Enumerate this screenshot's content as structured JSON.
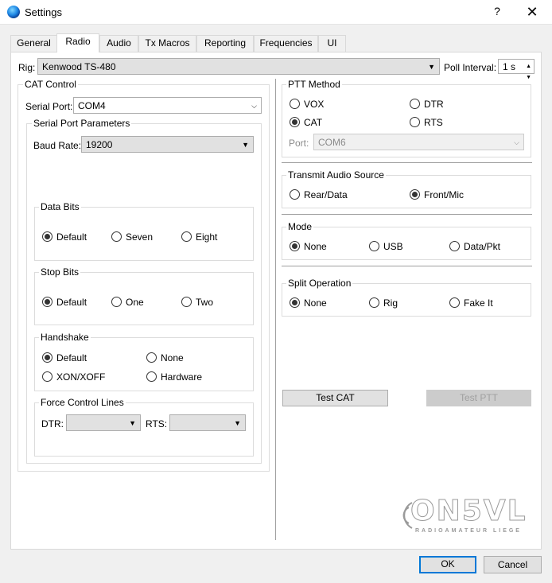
{
  "window": {
    "title": "Settings",
    "help_glyph": "?",
    "close_glyph": "✕"
  },
  "tabs": [
    {
      "label": "General"
    },
    {
      "label": "Radio",
      "active": true
    },
    {
      "label": "Audio"
    },
    {
      "label": "Tx Macros"
    },
    {
      "label": "Reporting"
    },
    {
      "label": "Frequencies"
    },
    {
      "label": "UI"
    }
  ],
  "rig": {
    "label": "Rig:",
    "value": "Kenwood TS-480",
    "poll_label": "Poll Interval:",
    "poll_value": "1 s"
  },
  "cat": {
    "title": "CAT Control",
    "serial_port_label": "Serial Port:",
    "serial_port_value": "COM4",
    "params_title": "Serial Port Parameters",
    "baud_label": "Baud Rate:",
    "baud_value": "19200",
    "data_bits": {
      "title": "Data Bits",
      "options": [
        "Default",
        "Seven",
        "Eight"
      ],
      "selected": "Default"
    },
    "stop_bits": {
      "title": "Stop Bits",
      "options": [
        "Default",
        "One",
        "Two"
      ],
      "selected": "Default"
    },
    "handshake": {
      "title": "Handshake",
      "options": [
        "Default",
        "None",
        "XON/XOFF",
        "Hardware"
      ],
      "selected": "Default"
    },
    "force": {
      "title": "Force Control Lines",
      "dtr_label": "DTR:",
      "rts_label": "RTS:"
    }
  },
  "ptt": {
    "title": "PTT Method",
    "options": [
      "VOX",
      "DTR",
      "CAT",
      "RTS"
    ],
    "selected": "CAT",
    "port_label": "Port:",
    "port_value": "COM6"
  },
  "tx_audio": {
    "title": "Transmit Audio Source",
    "options": [
      "Rear/Data",
      "Front/Mic"
    ],
    "selected": "Front/Mic"
  },
  "mode": {
    "title": "Mode",
    "options": [
      "None",
      "USB",
      "Data/Pkt"
    ],
    "selected": "None"
  },
  "split": {
    "title": "Split Operation",
    "options": [
      "None",
      "Rig",
      "Fake It"
    ],
    "selected": "None"
  },
  "buttons": {
    "test_cat": "Test CAT",
    "test_ptt": "Test PTT",
    "ok": "OK",
    "cancel": "Cancel"
  },
  "logo": {
    "main": "ON5VL",
    "sub": "RADIOAMATEUR LIEGE"
  },
  "colors": {
    "accent": "#0078d7",
    "panel_bg": "#ffffff",
    "window_bg": "#f0f0f0"
  },
  "icons": {
    "dropdown": "chevron-down-icon",
    "app": "globe-icon"
  }
}
